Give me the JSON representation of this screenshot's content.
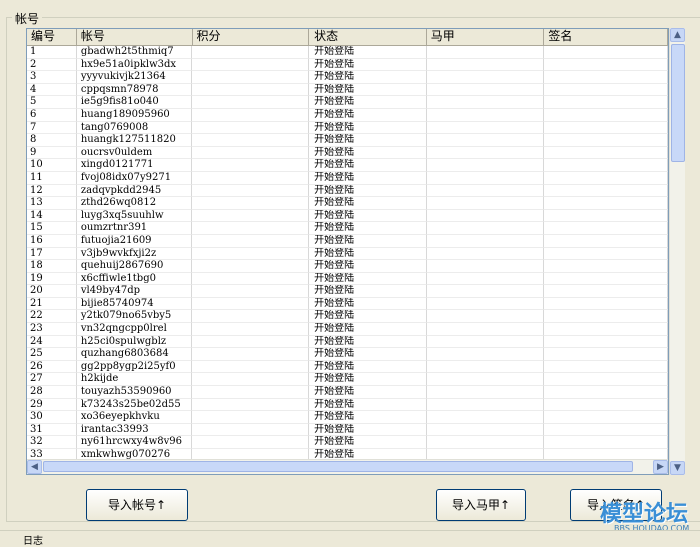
{
  "group_title": "帐号",
  "columns": [
    "编号",
    "帐号",
    "积分",
    "状态",
    "马甲",
    "签名"
  ],
  "rows": [
    {
      "id": "1",
      "account": "gbadwh2t5thmiq7",
      "score": "",
      "status": "开始登陆",
      "vest": "",
      "signature": ""
    },
    {
      "id": "2",
      "account": "hx9e51a0ipklw3dx",
      "score": "",
      "status": "开始登陆",
      "vest": "",
      "signature": ""
    },
    {
      "id": "3",
      "account": "yyyvukivjk21364",
      "score": "",
      "status": "开始登陆",
      "vest": "",
      "signature": ""
    },
    {
      "id": "4",
      "account": "cppqsmn78978",
      "score": "",
      "status": "开始登陆",
      "vest": "",
      "signature": ""
    },
    {
      "id": "5",
      "account": "ie5g9fis81o040",
      "score": "",
      "status": "开始登陆",
      "vest": "",
      "signature": ""
    },
    {
      "id": "6",
      "account": "huang189095960",
      "score": "",
      "status": "开始登陆",
      "vest": "",
      "signature": ""
    },
    {
      "id": "7",
      "account": "tang0769008",
      "score": "",
      "status": "开始登陆",
      "vest": "",
      "signature": ""
    },
    {
      "id": "8",
      "account": "huangk127511820",
      "score": "",
      "status": "开始登陆",
      "vest": "",
      "signature": ""
    },
    {
      "id": "9",
      "account": "oucrsv0uldem",
      "score": "",
      "status": "开始登陆",
      "vest": "",
      "signature": ""
    },
    {
      "id": "10",
      "account": "xingd0121771",
      "score": "",
      "status": "开始登陆",
      "vest": "",
      "signature": ""
    },
    {
      "id": "11",
      "account": "fvoj08idx07y9271",
      "score": "",
      "status": "开始登陆",
      "vest": "",
      "signature": ""
    },
    {
      "id": "12",
      "account": "zadqvpkdd2945",
      "score": "",
      "status": "开始登陆",
      "vest": "",
      "signature": ""
    },
    {
      "id": "13",
      "account": "zthd26wq0812",
      "score": "",
      "status": "开始登陆",
      "vest": "",
      "signature": ""
    },
    {
      "id": "14",
      "account": "luyg3xq5suuhlw",
      "score": "",
      "status": "开始登陆",
      "vest": "",
      "signature": ""
    },
    {
      "id": "15",
      "account": "oumzrtnr391",
      "score": "",
      "status": "开始登陆",
      "vest": "",
      "signature": ""
    },
    {
      "id": "16",
      "account": "futuojia21609",
      "score": "",
      "status": "开始登陆",
      "vest": "",
      "signature": ""
    },
    {
      "id": "17",
      "account": "v3jb9wvkfxji2z",
      "score": "",
      "status": "开始登陆",
      "vest": "",
      "signature": ""
    },
    {
      "id": "18",
      "account": "quehuij2867690",
      "score": "",
      "status": "开始登陆",
      "vest": "",
      "signature": ""
    },
    {
      "id": "19",
      "account": "x6cffiwle1tbg0",
      "score": "",
      "status": "开始登陆",
      "vest": "",
      "signature": ""
    },
    {
      "id": "20",
      "account": "vl49by47dp",
      "score": "",
      "status": "开始登陆",
      "vest": "",
      "signature": ""
    },
    {
      "id": "21",
      "account": "bijie85740974",
      "score": "",
      "status": "开始登陆",
      "vest": "",
      "signature": ""
    },
    {
      "id": "22",
      "account": "y2tk079no65vby5",
      "score": "",
      "status": "开始登陆",
      "vest": "",
      "signature": ""
    },
    {
      "id": "23",
      "account": "vn32qngcpp0lrel",
      "score": "",
      "status": "开始登陆",
      "vest": "",
      "signature": ""
    },
    {
      "id": "24",
      "account": "h25ci0spulwgblz",
      "score": "",
      "status": "开始登陆",
      "vest": "",
      "signature": ""
    },
    {
      "id": "25",
      "account": "quzhang6803684",
      "score": "",
      "status": "开始登陆",
      "vest": "",
      "signature": ""
    },
    {
      "id": "26",
      "account": "gg2pp8ygp2i25yf0",
      "score": "",
      "status": "开始登陆",
      "vest": "",
      "signature": ""
    },
    {
      "id": "27",
      "account": "h2kijde",
      "score": "",
      "status": "开始登陆",
      "vest": "",
      "signature": ""
    },
    {
      "id": "28",
      "account": "touyazh53590960",
      "score": "",
      "status": "开始登陆",
      "vest": "",
      "signature": ""
    },
    {
      "id": "29",
      "account": "k73243s25be02d55",
      "score": "",
      "status": "开始登陆",
      "vest": "",
      "signature": ""
    },
    {
      "id": "30",
      "account": "xo36eyepkhvku",
      "score": "",
      "status": "开始登陆",
      "vest": "",
      "signature": ""
    },
    {
      "id": "31",
      "account": "irantac33993",
      "score": "",
      "status": "开始登陆",
      "vest": "",
      "signature": ""
    },
    {
      "id": "32",
      "account": "ny61hrcwxy4w8v96",
      "score": "",
      "status": "开始登陆",
      "vest": "",
      "signature": ""
    },
    {
      "id": "33",
      "account": "xmkwhwg070276",
      "score": "",
      "status": "开始登陆",
      "vest": "",
      "signature": ""
    }
  ],
  "buttons": {
    "import_accounts": "导入帐号↑",
    "import_vests": "导入马甲↑",
    "import_signatures": "导入签名↑"
  },
  "scroll": {
    "vertical_position": 0.0,
    "horizontal_position": 0.0
  },
  "watermark": {
    "text": "模型论坛",
    "url": "BBS.HOUDAO.COM"
  },
  "bottom_label": "日志"
}
